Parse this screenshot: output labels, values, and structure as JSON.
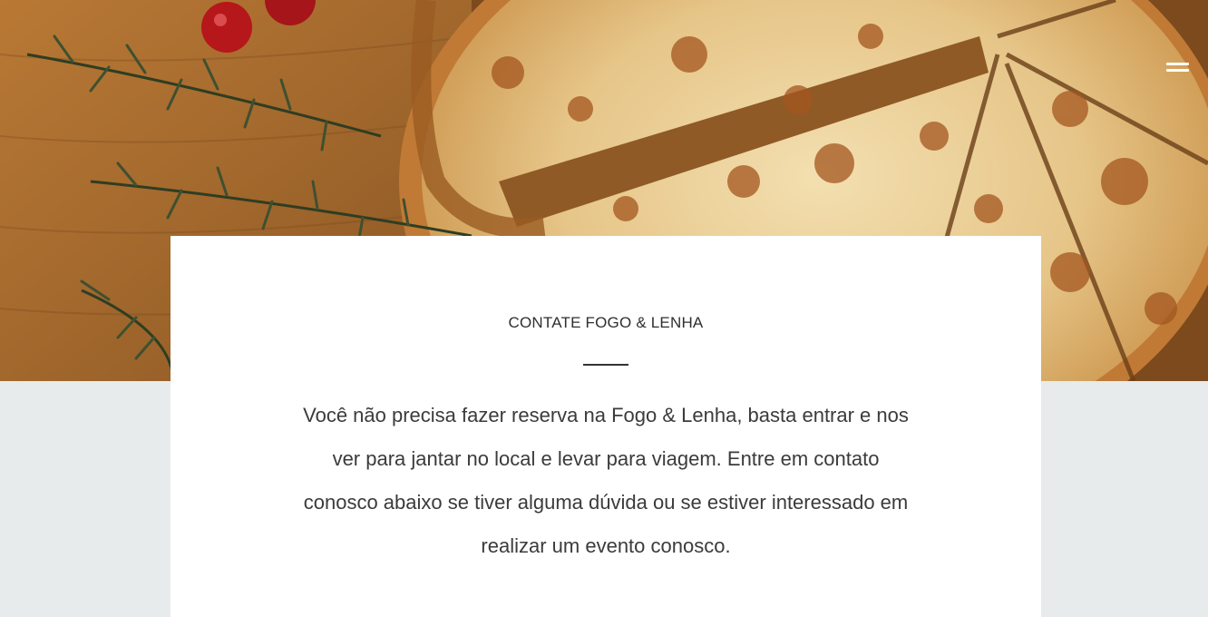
{
  "header": {
    "hero_image": "pizza-on-wooden-board",
    "menu_icon": "hamburger-menu-icon"
  },
  "contact": {
    "title": "CONTATE FOGO & LENHA",
    "body": "Você não precisa fazer reserva na Fogo & Lenha, basta entrar e nos ver para jantar no local e levar para viagem. Entre em contato conosco abaixo se tiver alguma dúvida ou se estiver interessado em realizar um evento conosco."
  },
  "colors": {
    "page_background": "#e8ebeb",
    "card_background": "#ffffff",
    "text": "#3b3b3b"
  }
}
